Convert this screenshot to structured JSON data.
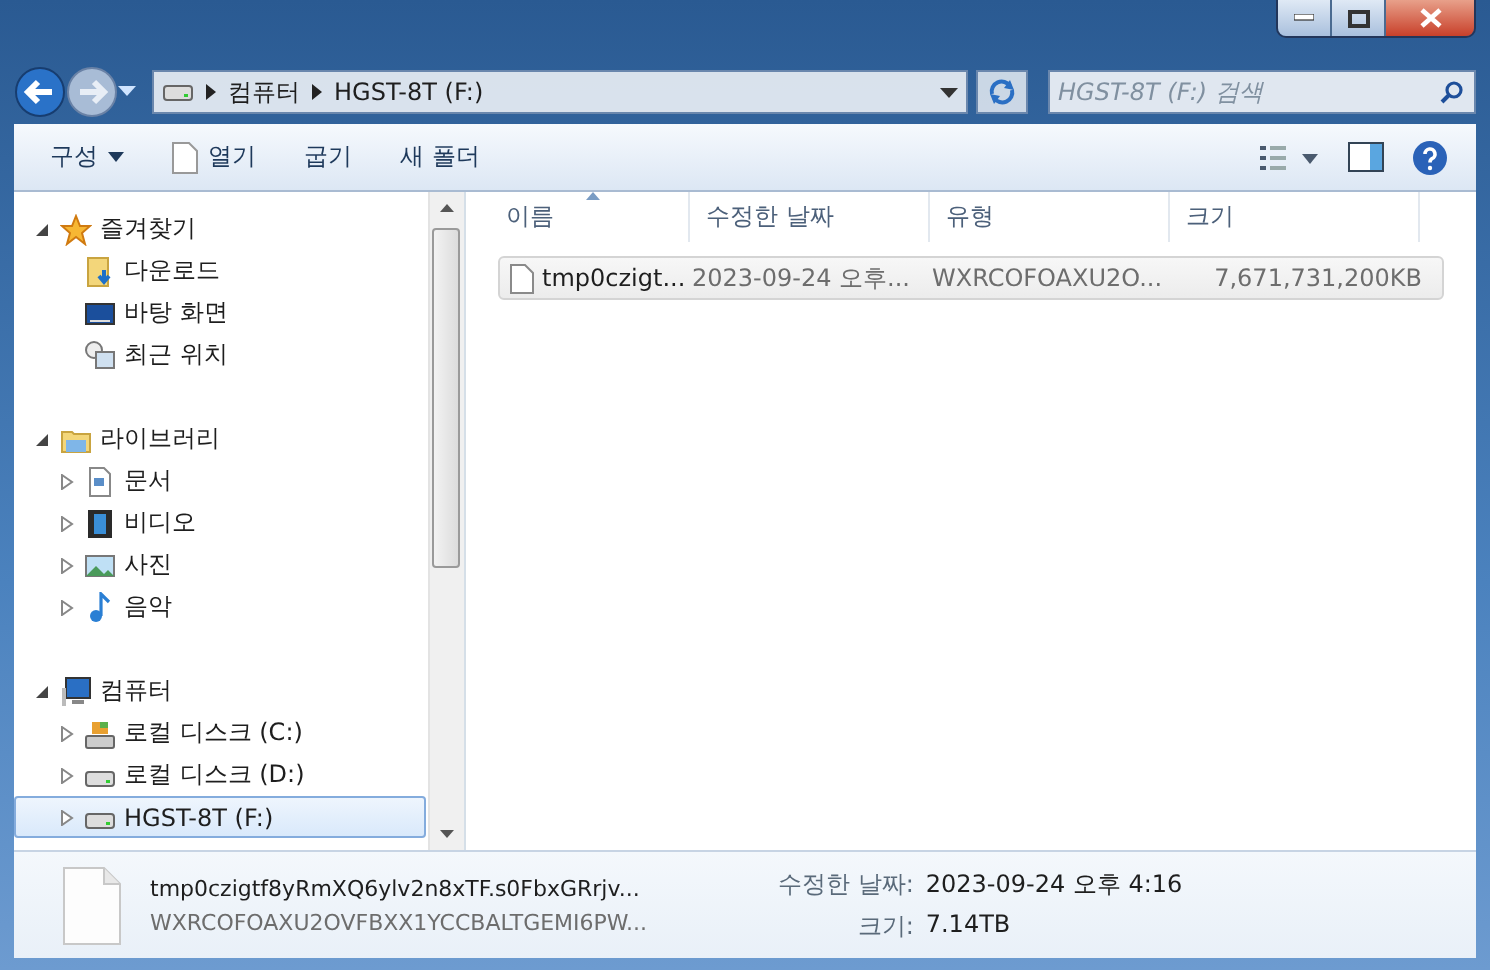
{
  "address": {
    "path": [
      "컴퓨터",
      "HGST-8T (F:)"
    ]
  },
  "search": {
    "placeholder": "HGST-8T (F:) 검색"
  },
  "toolbar": [
    {
      "label": "구성",
      "kind": "menu"
    },
    {
      "label": "열기",
      "kind": "open"
    },
    {
      "label": "굽기",
      "kind": "plain"
    },
    {
      "label": "새 폴더",
      "kind": "plain"
    }
  ],
  "nav": [
    {
      "label": "즐겨찾기",
      "kind": "star",
      "expanded": true,
      "selected": false,
      "children": [
        {
          "label": "다운로드",
          "kind": "download",
          "selected": false
        },
        {
          "label": "바탕 화면",
          "kind": "desktop",
          "selected": false
        },
        {
          "label": "최근 위치",
          "kind": "recent",
          "selected": false
        }
      ]
    },
    {
      "label": "라이브러리",
      "kind": "library",
      "expanded": true,
      "selected": false,
      "children": [
        {
          "label": "문서",
          "kind": "document",
          "expanded": false,
          "selected": false
        },
        {
          "label": "비디오",
          "kind": "video",
          "expanded": false,
          "selected": false
        },
        {
          "label": "사진",
          "kind": "photo",
          "expanded": false,
          "selected": false
        },
        {
          "label": "음악",
          "kind": "music",
          "expanded": false,
          "selected": false
        }
      ]
    },
    {
      "label": "컴퓨터",
      "kind": "computer",
      "expanded": true,
      "selected": false,
      "children": [
        {
          "label": "로컬 디스크 (C:)",
          "kind": "system-drive",
          "expanded": false,
          "selected": false
        },
        {
          "label": "로컬 디스크 (D:)",
          "kind": "drive",
          "expanded": false,
          "selected": false
        },
        {
          "label": "HGST-8T (F:)",
          "kind": "drive",
          "expanded": false,
          "selected": true
        }
      ]
    }
  ],
  "columns": [
    {
      "label": "이름",
      "sorted": true
    },
    {
      "label": "수정한 날짜",
      "sorted": false
    },
    {
      "label": "유형",
      "sorted": false
    },
    {
      "label": "크기",
      "sorted": false
    }
  ],
  "files": [
    {
      "name": "tmp0czigt...",
      "modified": "2023-09-24 오후...",
      "type": "WXRCOFOAXU2O...",
      "size": "7,671,731,200KB",
      "selected": true
    }
  ],
  "details": {
    "name": "tmp0czigtf8yRmXQ6ylv2n8xTF.s0FbxGRrjv...",
    "type": "WXRCOFOAXU2OVFBXX1YCCBALTGEMI6PW...",
    "fields": [
      {
        "label": "수정한 날짜:",
        "value": "2023-09-24 오후 4:16"
      },
      {
        "label": "크기:",
        "value": "7.14TB"
      }
    ]
  }
}
